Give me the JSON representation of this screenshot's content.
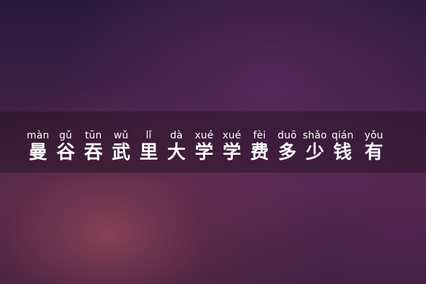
{
  "title": {
    "chars": [
      {
        "pinyin": "màn",
        "hanzi": "曼"
      },
      {
        "pinyin": "gǔ",
        "hanzi": "谷"
      },
      {
        "pinyin": "tūn",
        "hanzi": "吞"
      },
      {
        "pinyin": "wǔ",
        "hanzi": "武"
      },
      {
        "pinyin": "lǐ",
        "hanzi": "里"
      },
      {
        "pinyin": "dà",
        "hanzi": "大"
      },
      {
        "pinyin": "xué",
        "hanzi": "学"
      },
      {
        "pinyin": "xué",
        "hanzi": "学"
      },
      {
        "pinyin": "fèi",
        "hanzi": "费"
      },
      {
        "pinyin": "duō",
        "hanzi": "多"
      },
      {
        "pinyin": "shǎo",
        "hanzi": "少"
      },
      {
        "pinyin": "qián",
        "hanzi": "钱"
      },
      {
        "pinyin": "yǒu",
        "hanzi": "有"
      }
    ]
  },
  "colors": {
    "text": "#ffffff",
    "background_dark": "#2b1a3a",
    "background_glow": "#be5a64"
  }
}
